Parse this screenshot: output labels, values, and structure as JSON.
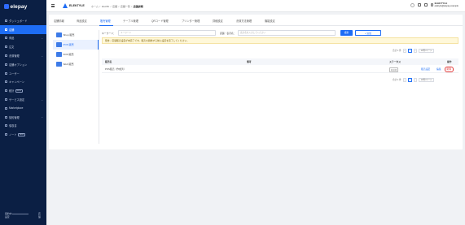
{
  "sidebar": {
    "logo": "elepay",
    "items": [
      {
        "label": "ダッシュボード",
        "active": false,
        "chevron": false
      },
      {
        "label": "店舗",
        "active": true,
        "chevron": false
      },
      {
        "label": "商品",
        "active": false,
        "chevron": true
      },
      {
        "label": "注文",
        "active": false,
        "chevron": false
      },
      {
        "label": "決済管理",
        "active": false,
        "chevron": true
      },
      {
        "label": "店舗オプション",
        "active": false,
        "chevron": false
      },
      {
        "label": "ユーザー",
        "active": false,
        "chevron": false
      },
      {
        "label": "キャンペーン",
        "active": false,
        "chevron": false
      },
      {
        "label": "統計",
        "active": false,
        "chevron": false,
        "badge": "NEW"
      },
      {
        "label": "サービス設定",
        "active": false,
        "chevron": true
      },
      {
        "label": "Marketplace",
        "active": false,
        "chevron": false
      },
      {
        "label": "契約管理",
        "active": false,
        "chevron": true
      },
      {
        "label": "領収書",
        "active": false,
        "chevron": false
      },
      {
        "label": "ノート",
        "active": false,
        "chevron": false,
        "badge": "NEW"
      }
    ],
    "footer_label": "契約中",
    "footer_sub": "設定",
    "footer_right_top": "店",
    "footer_right_bottom": "舗"
  },
  "header": {
    "store_name": "ELEKTYLE",
    "breadcrumbs": [
      "ホーム",
      "/",
      "ElekBit",
      "/",
      "店舗",
      "/",
      "店舗一覧",
      "/"
    ],
    "breadcrumb_current": "店舗詳細",
    "user_name": "ELEKTYLE",
    "user_email": "elektyle@elepay.example"
  },
  "tabs": [
    "店舗情報",
    "商品設定",
    "販売管理",
    "テーブル管理",
    "QRコード管理",
    "プリンター管理",
    "詳細設定",
    "決済方法管理",
    "機能設定"
  ],
  "active_tab_index": 2,
  "categories": [
    {
      "label": "Shop 販売",
      "active": false
    },
    {
      "label": "POS 販売",
      "active": true
    },
    {
      "label": "KDS 販売",
      "active": false
    },
    {
      "label": "Web 販売",
      "active": false
    }
  ],
  "search": {
    "keyword_label": "キーワード：",
    "keyword_placeholder": "キーワード",
    "name_label": "店舗・表示名：",
    "name_placeholder": "表示名を入力してください",
    "search_button": "検索",
    "add_button": "+ 追加"
  },
  "notice": "警告：店舗販売設定が未完了です。販売を開始する前に設定を完了してください。",
  "pagination_top": {
    "total": "合計 1 件",
    "current": "1",
    "per_page": "10件/ページ"
  },
  "pagination_bottom": {
    "total": "合計 1 件",
    "current": "1",
    "per_page": "10件/ページ"
  },
  "table": {
    "headers": {
      "name": "販売名",
      "note": "備考",
      "status": "ステータス",
      "ops": "操作"
    },
    "rows": [
      {
        "name": "POS販売（作成済）",
        "note": "",
        "status": "有効化",
        "op_setting": "販売設定",
        "op_edit": "編集",
        "op_delete": "削除"
      }
    ]
  },
  "colors": {
    "primary": "#1e6df5",
    "sidebar_bg": "#0b1f44",
    "danger": "#e23b3b",
    "notice_bg": "#fff8d9"
  }
}
